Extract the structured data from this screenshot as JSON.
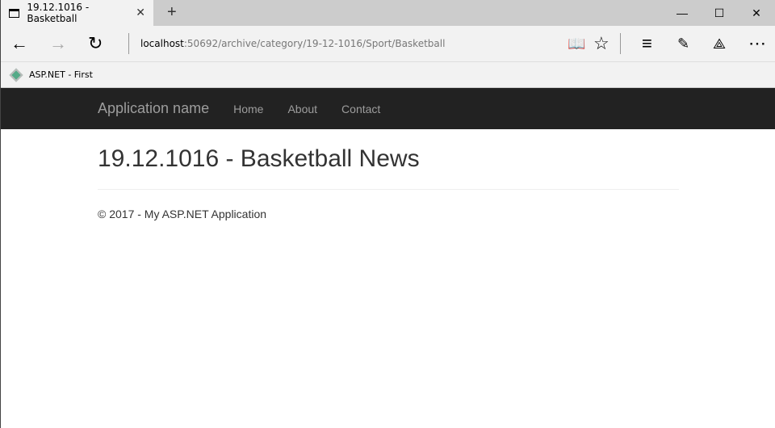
{
  "browser": {
    "tab_title": "19.12.1016 - Basketball",
    "url_host": "localhost",
    "url_path": ":50692/archive/category/19-12-1016/Sport/Basketball",
    "favorite": "ASP.NET - First"
  },
  "navbar": {
    "brand": "Application name",
    "links": [
      "Home",
      "About",
      "Contact"
    ]
  },
  "page": {
    "title": "19.12.1016 - Basketball News",
    "footer": "© 2017 - My ASP.NET Application"
  }
}
